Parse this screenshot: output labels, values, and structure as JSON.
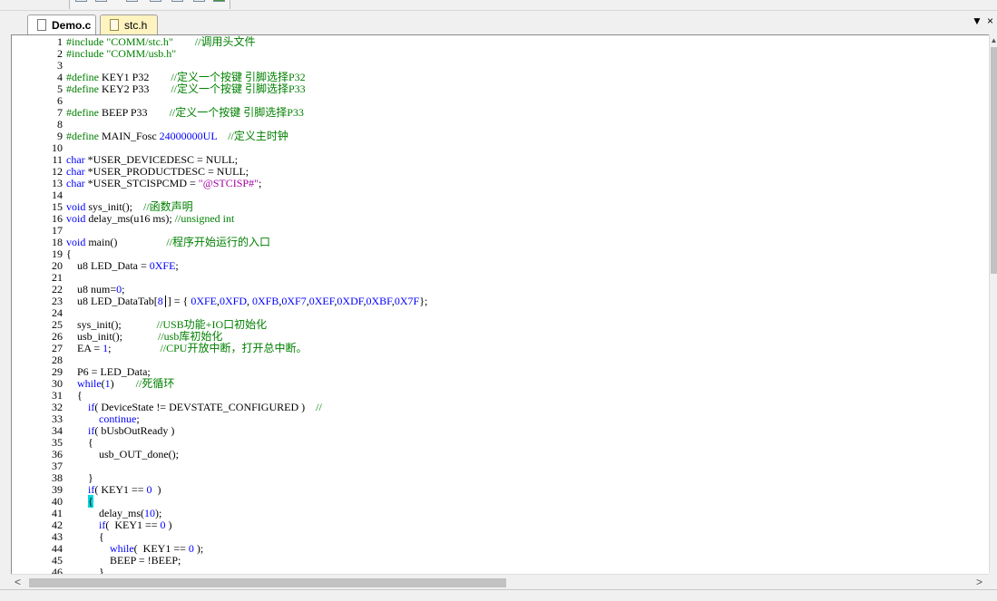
{
  "tabs": [
    {
      "label": "Demo.c",
      "active": true
    },
    {
      "label": "stc.h",
      "active": false
    }
  ],
  "tab_controls": {
    "dropdown": "▼",
    "close": "×"
  },
  "code_lines": [
    {
      "n": "1",
      "t": [
        [
          "pp",
          "#include \"COMM/stc.h\""
        ],
        [
          "",
          "        "
        ],
        [
          "cm",
          "//调用头文件"
        ]
      ]
    },
    {
      "n": "2",
      "t": [
        [
          "pp",
          "#include \"COMM/usb.h\""
        ]
      ]
    },
    {
      "n": "3",
      "t": []
    },
    {
      "n": "4",
      "t": [
        [
          "pp",
          "#define"
        ],
        [
          "",
          " KEY1 P32        "
        ],
        [
          "cm",
          "//定义一个按键 引脚选择P32"
        ]
      ]
    },
    {
      "n": "5",
      "t": [
        [
          "pp",
          "#define"
        ],
        [
          "",
          " KEY2 P33        "
        ],
        [
          "cm",
          "//定义一个按键 引脚选择P33"
        ]
      ]
    },
    {
      "n": "6",
      "t": []
    },
    {
      "n": "7",
      "t": [
        [
          "pp",
          "#define"
        ],
        [
          "",
          " BEEP P33        "
        ],
        [
          "cm",
          "//定义一个按键 引脚选择P33"
        ]
      ]
    },
    {
      "n": "8",
      "t": []
    },
    {
      "n": "9",
      "t": [
        [
          "pp",
          "#define"
        ],
        [
          "",
          " MAIN_Fosc "
        ],
        [
          "num",
          "24000000UL"
        ],
        [
          "",
          "    "
        ],
        [
          "cm",
          "//定义主时钟"
        ]
      ]
    },
    {
      "n": "10",
      "t": []
    },
    {
      "n": "11",
      "t": [
        [
          "kw",
          "char"
        ],
        [
          "",
          " *USER_DEVICEDESC = NULL;"
        ]
      ]
    },
    {
      "n": "12",
      "t": [
        [
          "kw",
          "char"
        ],
        [
          "",
          " *USER_PRODUCTDESC = NULL;"
        ]
      ]
    },
    {
      "n": "13",
      "t": [
        [
          "kw",
          "char"
        ],
        [
          "",
          " *USER_STCISPCMD = "
        ],
        [
          "str",
          "\"@STCISP#\""
        ],
        [
          "",
          ";"
        ]
      ]
    },
    {
      "n": "14",
      "t": []
    },
    {
      "n": "15",
      "t": [
        [
          "kw",
          "void"
        ],
        [
          "",
          " sys_init();    "
        ],
        [
          "cm",
          "//函数声明"
        ]
      ]
    },
    {
      "n": "16",
      "t": [
        [
          "kw",
          "void"
        ],
        [
          "",
          " delay_ms(u16 ms); "
        ],
        [
          "cm",
          "//unsigned int"
        ]
      ]
    },
    {
      "n": "17",
      "t": []
    },
    {
      "n": "18",
      "t": [
        [
          "kw",
          "void"
        ],
        [
          "",
          " main()                  "
        ],
        [
          "cm",
          "//程序开始运行的入口"
        ]
      ]
    },
    {
      "n": "19",
      "t": [
        [
          "",
          "{"
        ]
      ]
    },
    {
      "n": "20",
      "t": [
        [
          "",
          "    u8 LED_Data = "
        ],
        [
          "num",
          "0XFE"
        ],
        [
          "",
          ";"
        ]
      ]
    },
    {
      "n": "21",
      "t": []
    },
    {
      "n": "22",
      "t": [
        [
          "",
          "    u8 num="
        ],
        [
          "num",
          "0"
        ],
        [
          "",
          ";"
        ]
      ]
    },
    {
      "n": "23",
      "t": [
        [
          "",
          "    u8 LED_DataTab["
        ],
        [
          "num",
          "8"
        ],
        [
          "caret",
          ""
        ],
        [
          "",
          "] = { "
        ],
        [
          "num",
          "0XFE"
        ],
        [
          "",
          ","
        ],
        [
          "num",
          "0XFD"
        ],
        [
          "",
          ", "
        ],
        [
          "num",
          "0XFB"
        ],
        [
          "",
          ","
        ],
        [
          "num",
          "0XF7"
        ],
        [
          "",
          ","
        ],
        [
          "num",
          "0XEF"
        ],
        [
          "",
          ","
        ],
        [
          "num",
          "0XDF"
        ],
        [
          "",
          ","
        ],
        [
          "num",
          "0XBF"
        ],
        [
          "",
          ","
        ],
        [
          "num",
          "0X7F"
        ],
        [
          "",
          "};"
        ]
      ]
    },
    {
      "n": "24",
      "t": []
    },
    {
      "n": "25",
      "t": [
        [
          "",
          "    sys_init();             "
        ],
        [
          "cm",
          "//USB功能+IO口初始化"
        ]
      ]
    },
    {
      "n": "26",
      "t": [
        [
          "",
          "    usb_init();             "
        ],
        [
          "cm",
          "//usb库初始化"
        ]
      ]
    },
    {
      "n": "27",
      "t": [
        [
          "",
          "    EA = "
        ],
        [
          "num",
          "1"
        ],
        [
          "",
          ";                  "
        ],
        [
          "cm",
          "//CPU开放中断，打开总中断。"
        ]
      ]
    },
    {
      "n": "28",
      "t": []
    },
    {
      "n": "29",
      "t": [
        [
          "",
          "    P6 = LED_Data;"
        ]
      ]
    },
    {
      "n": "30",
      "t": [
        [
          "",
          "    "
        ],
        [
          "kw",
          "while"
        ],
        [
          "",
          "("
        ],
        [
          "num",
          "1"
        ],
        [
          "",
          ")        "
        ],
        [
          "cm",
          "//死循环"
        ]
      ]
    },
    {
      "n": "31",
      "t": [
        [
          "",
          "    {"
        ]
      ]
    },
    {
      "n": "32",
      "t": [
        [
          "",
          "        "
        ],
        [
          "kw",
          "if"
        ],
        [
          "",
          "( DeviceState != DEVSTATE_CONFIGURED )    "
        ],
        [
          "cm",
          "//"
        ]
      ]
    },
    {
      "n": "33",
      "t": [
        [
          "",
          "            "
        ],
        [
          "kw",
          "continue"
        ],
        [
          "",
          ";"
        ]
      ]
    },
    {
      "n": "34",
      "t": [
        [
          "",
          "        "
        ],
        [
          "kw",
          "if"
        ],
        [
          "",
          "( bUsbOutReady )"
        ]
      ]
    },
    {
      "n": "35",
      "t": [
        [
          "",
          "        {"
        ]
      ]
    },
    {
      "n": "36",
      "t": [
        [
          "",
          "            usb_OUT_done();"
        ]
      ]
    },
    {
      "n": "37",
      "t": []
    },
    {
      "n": "38",
      "t": [
        [
          "",
          "        }"
        ]
      ]
    },
    {
      "n": "39",
      "t": [
        [
          "",
          "        "
        ],
        [
          "kw",
          "if"
        ],
        [
          "",
          "( KEY1 == "
        ],
        [
          "num",
          "0"
        ],
        [
          "",
          "  )"
        ]
      ]
    },
    {
      "n": "40",
      "t": [
        [
          "",
          "        "
        ],
        [
          "hl",
          "{"
        ]
      ]
    },
    {
      "n": "41",
      "t": [
        [
          "",
          "            delay_ms("
        ],
        [
          "num",
          "10"
        ],
        [
          "",
          ");"
        ]
      ]
    },
    {
      "n": "42",
      "t": [
        [
          "",
          "            "
        ],
        [
          "kw",
          "if"
        ],
        [
          "",
          "(  KEY1 == "
        ],
        [
          "num",
          "0"
        ],
        [
          "",
          " )"
        ]
      ]
    },
    {
      "n": "43",
      "t": [
        [
          "",
          "            {"
        ]
      ]
    },
    {
      "n": "44",
      "t": [
        [
          "",
          "                "
        ],
        [
          "kw",
          "while"
        ],
        [
          "",
          "(  KEY1 == "
        ],
        [
          "num",
          "0"
        ],
        [
          "",
          " );"
        ]
      ]
    },
    {
      "n": "45",
      "t": [
        [
          "",
          "                BEEP = !BEEP;"
        ]
      ]
    },
    {
      "n": "46",
      "t": [
        [
          "",
          "            }"
        ]
      ]
    }
  ]
}
